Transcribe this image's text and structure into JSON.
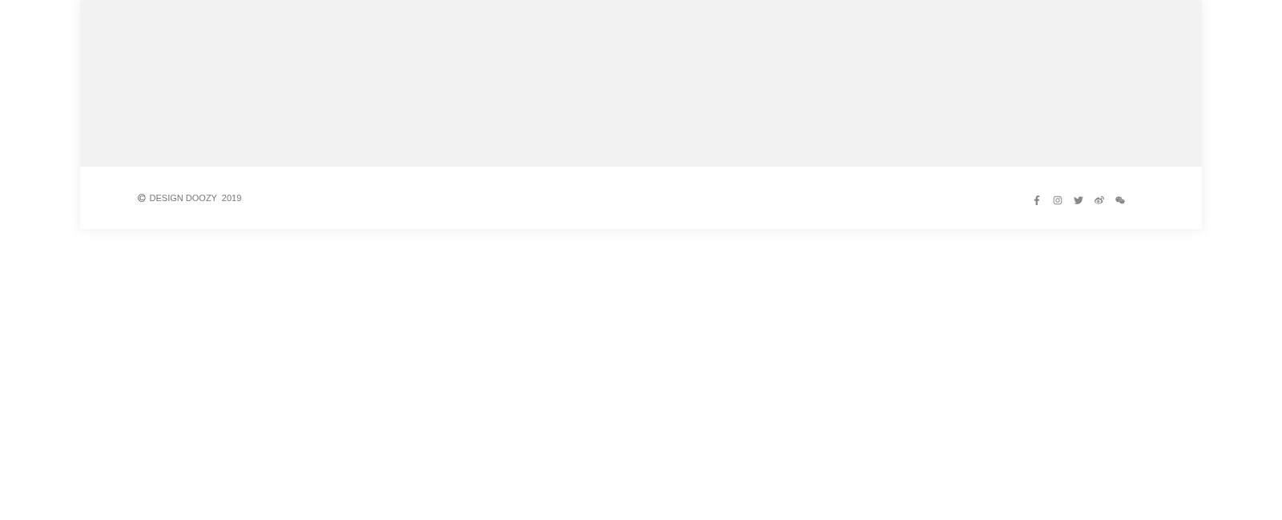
{
  "footer": {
    "copyright_symbol": "©",
    "copyright_text": "DESIGN DOOZY  2019",
    "social_links": [
      {
        "kind": "facebook"
      },
      {
        "kind": "instagram"
      },
      {
        "kind": "twitter"
      },
      {
        "kind": "weibo"
      },
      {
        "kind": "wechat"
      }
    ]
  }
}
